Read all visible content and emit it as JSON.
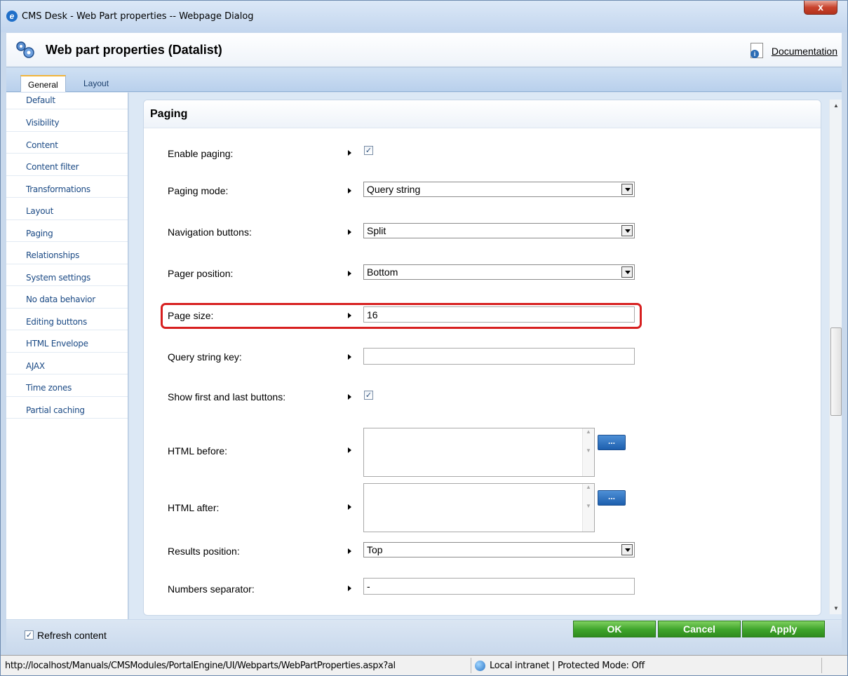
{
  "window": {
    "title": "CMS Desk - Web Part properties -- Webpage Dialog",
    "close_label": "x"
  },
  "header": {
    "title": "Web part properties (Datalist)",
    "doc_link": "Documentation"
  },
  "tabs": [
    {
      "label": "General",
      "active": true
    },
    {
      "label": "Layout",
      "active": false
    }
  ],
  "sidebar": {
    "items": [
      {
        "label": "Default"
      },
      {
        "label": "Visibility"
      },
      {
        "label": "Content"
      },
      {
        "label": "Content filter"
      },
      {
        "label": "Transformations"
      },
      {
        "label": "Layout"
      },
      {
        "label": "Paging"
      },
      {
        "label": "Relationships"
      },
      {
        "label": "System settings"
      },
      {
        "label": "No data behavior"
      },
      {
        "label": "Editing buttons"
      },
      {
        "label": "HTML Envelope"
      },
      {
        "label": "AJAX"
      },
      {
        "label": "Time zones"
      },
      {
        "label": "Partial caching"
      }
    ]
  },
  "panel": {
    "title": "Paging",
    "fields": {
      "enable_paging": {
        "label": "Enable paging:",
        "checked": true
      },
      "paging_mode": {
        "label": "Paging mode:",
        "value": "Query string"
      },
      "navigation_buttons": {
        "label": "Navigation buttons:",
        "value": "Split"
      },
      "pager_position": {
        "label": "Pager position:",
        "value": "Bottom"
      },
      "page_size": {
        "label": "Page size:",
        "value": "16"
      },
      "query_string_key": {
        "label": "Query string key:",
        "value": ""
      },
      "show_first_last": {
        "label": "Show first and last buttons:",
        "checked": true
      },
      "html_before": {
        "label": "HTML before:",
        "value": "",
        "button_label": "..."
      },
      "html_after": {
        "label": "HTML after:",
        "value": "",
        "button_label": "..."
      },
      "results_position": {
        "label": "Results position:",
        "value": "Top"
      },
      "numbers_separator": {
        "label": "Numbers separator:",
        "value": "-"
      }
    }
  },
  "footer": {
    "refresh_label": "Refresh content",
    "refresh_checked": true,
    "ok_label": "OK",
    "cancel_label": "Cancel",
    "apply_label": "Apply"
  },
  "statusbar": {
    "url": "http://localhost/Manuals/CMSModules/PortalEngine/UI/Webparts/WebPartProperties.aspx?al",
    "zone": "Local intranet | Protected Mode: Off"
  },
  "colors": {
    "highlight": "#d71f1f",
    "button_green": "#3ea32a",
    "sidebar_link": "#1b4a85"
  }
}
